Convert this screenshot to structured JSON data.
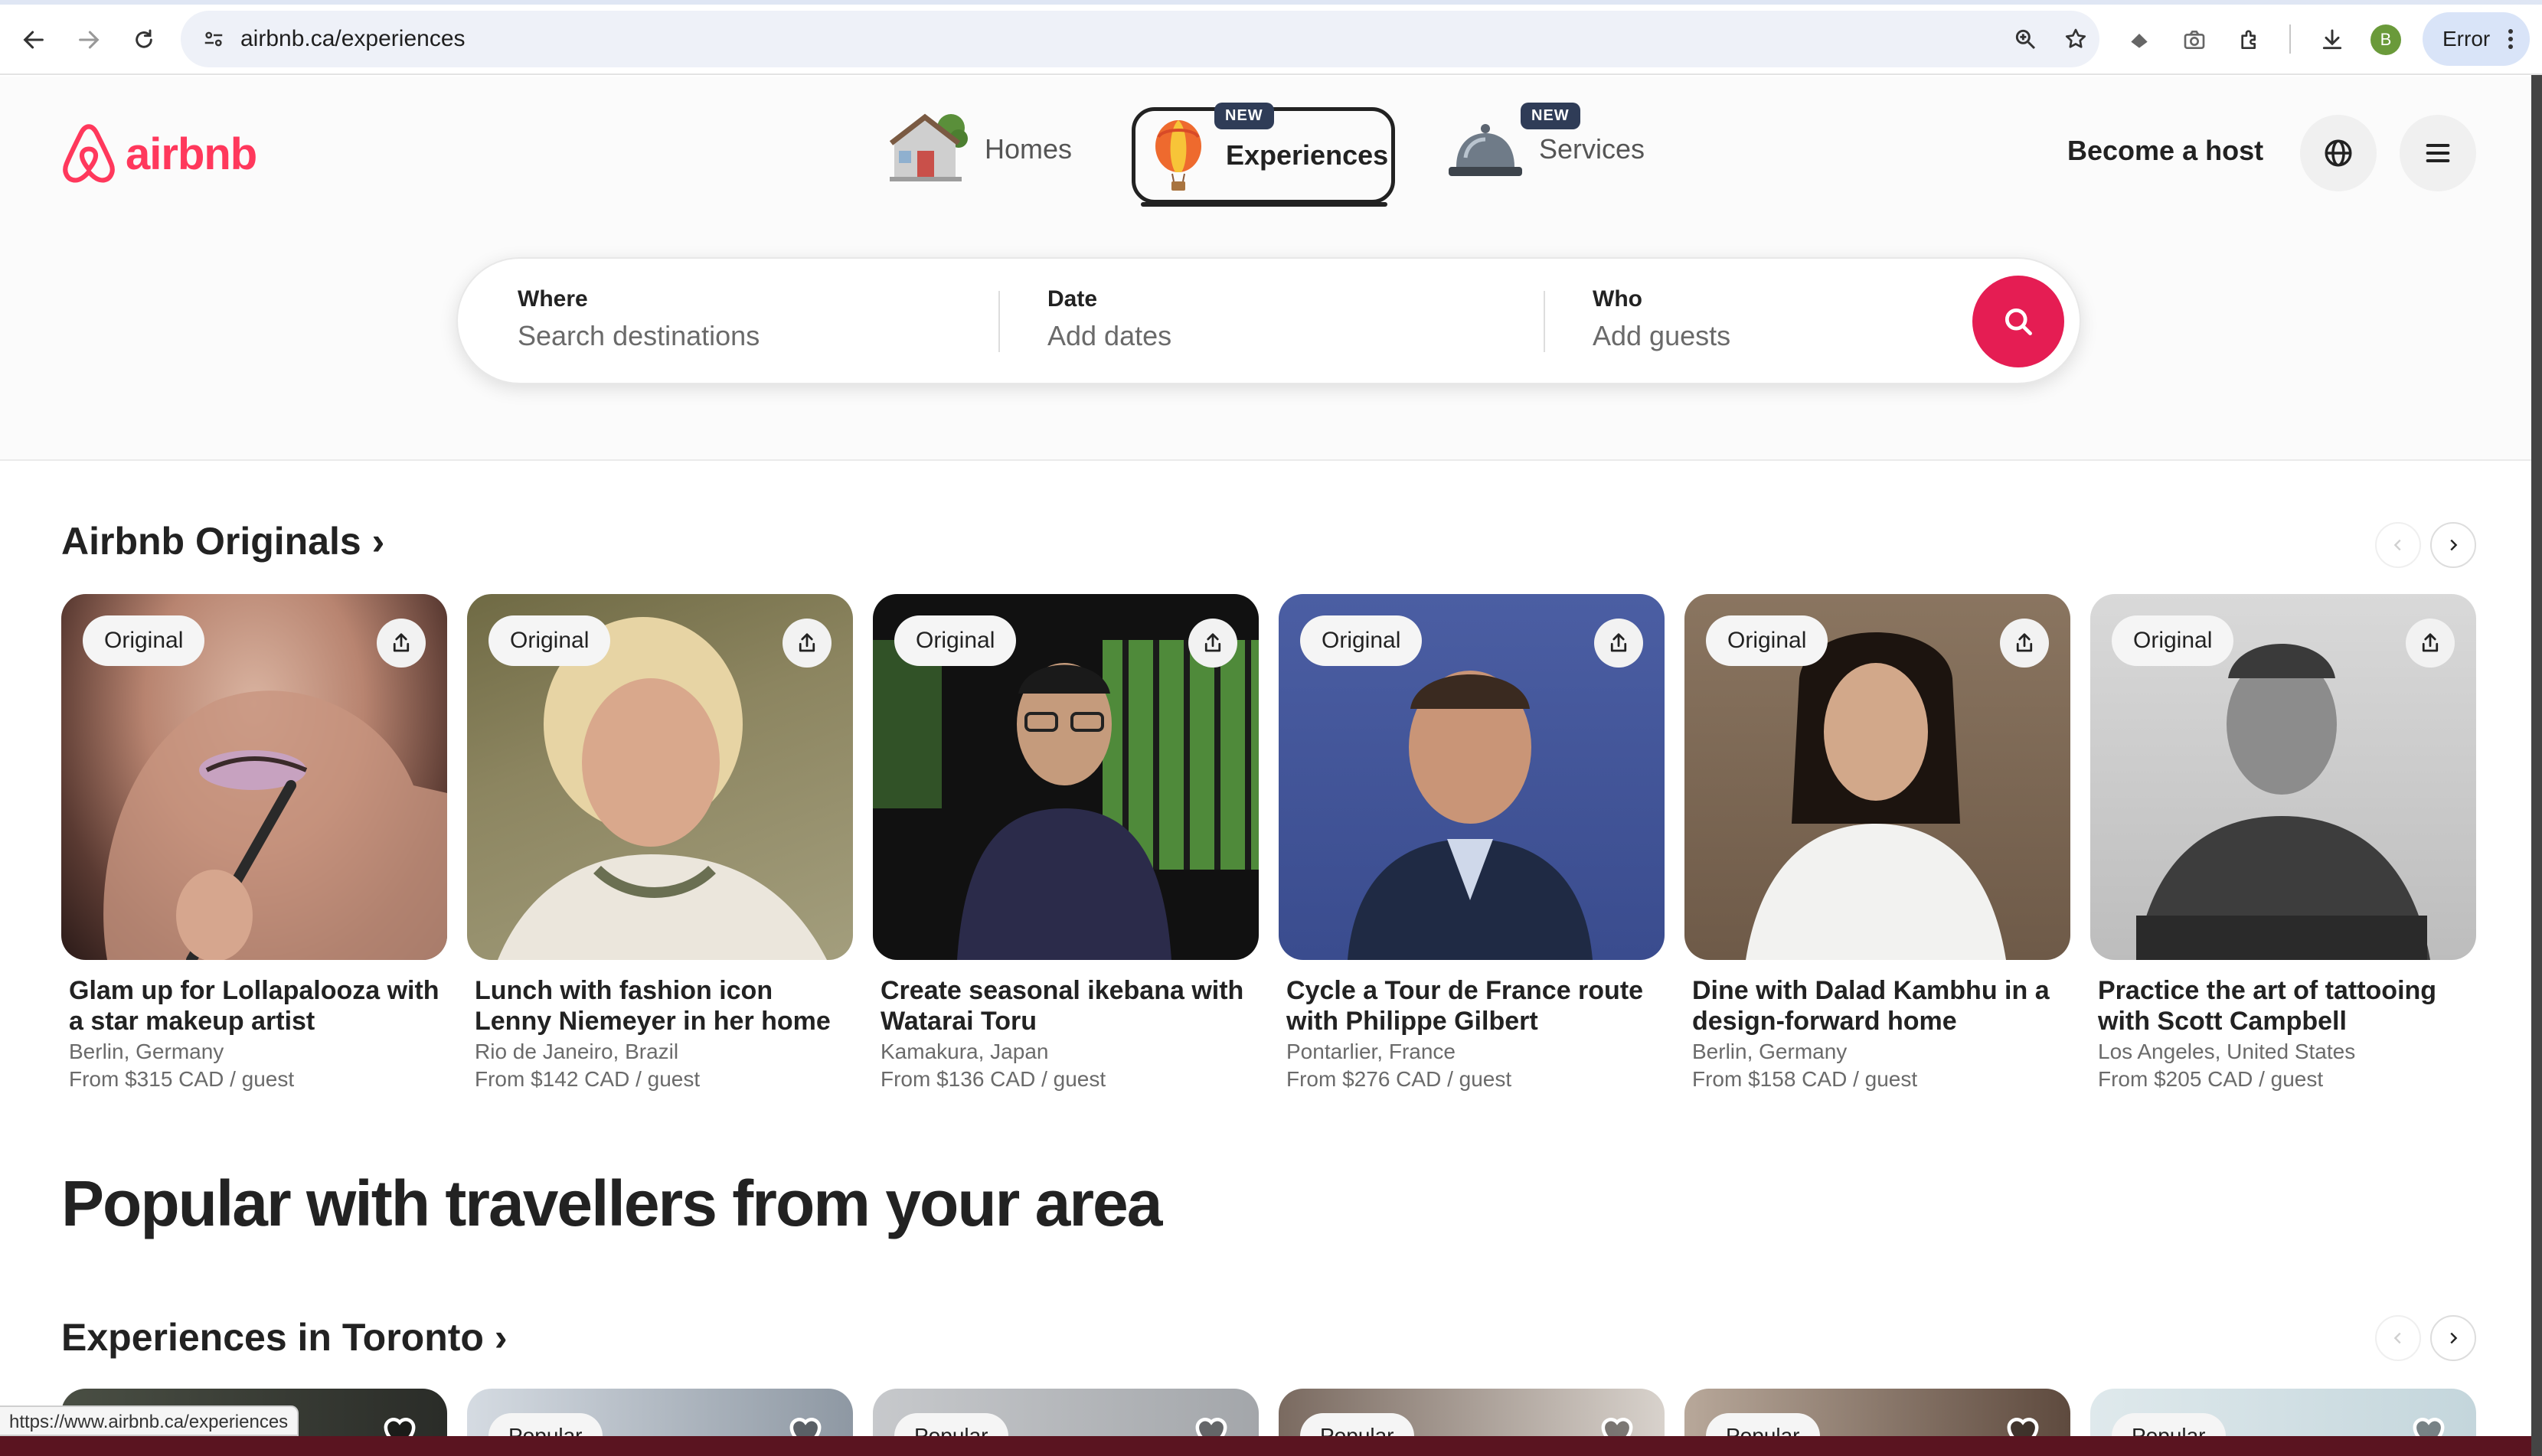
{
  "browser": {
    "url": "airbnb.ca/experiences",
    "profile_initial": "B",
    "error_label": "Error",
    "status_url": "https://www.airbnb.ca/experiences"
  },
  "header": {
    "logo_text": "airbnb",
    "brand_color": "#ff385c",
    "tabs": [
      {
        "label": "Homes",
        "new": false,
        "icon": "house-icon"
      },
      {
        "label": "Experiences",
        "new": true,
        "icon": "hot-air-balloon-icon"
      },
      {
        "label": "Services",
        "new": true,
        "icon": "service-bell-icon"
      }
    ],
    "new_badge": "NEW",
    "become_host": "Become a host"
  },
  "search": {
    "where_title": "Where",
    "where_placeholder": "Search destinations",
    "date_title": "Date",
    "date_placeholder": "Add dates",
    "who_title": "Who",
    "who_placeholder": "Add guests"
  },
  "originals": {
    "title": "Airbnb Originals ›",
    "badge": "Original",
    "cards": [
      {
        "title": "Glam up for Lollapalooza with a star makeup artist",
        "location": "Berlin, Germany",
        "price": "From $315 CAD / guest"
      },
      {
        "title": "Lunch with fashion icon Lenny Niemeyer in her home",
        "location": "Rio de Janeiro, Brazil",
        "price": "From $142 CAD / guest"
      },
      {
        "title": "Create seasonal ikebana with Watarai Toru",
        "location": "Kamakura, Japan",
        "price": "From $136 CAD / guest"
      },
      {
        "title": "Cycle a Tour de France route with Philippe Gilbert",
        "location": "Pontarlier, France",
        "price": "From $276 CAD / guest"
      },
      {
        "title": "Dine with Dalad Kambhu in a design-forward home",
        "location": "Berlin, Germany",
        "price": "From $158 CAD / guest"
      },
      {
        "title": "Practice the art of tattooing with Scott Campbell",
        "location": "Los Angeles, United States",
        "price": "From $205 CAD / guest"
      }
    ]
  },
  "popular": {
    "heading": "Popular with travellers from your area",
    "toronto_title": "Experiences in Toronto ›",
    "badge": "Popular"
  }
}
